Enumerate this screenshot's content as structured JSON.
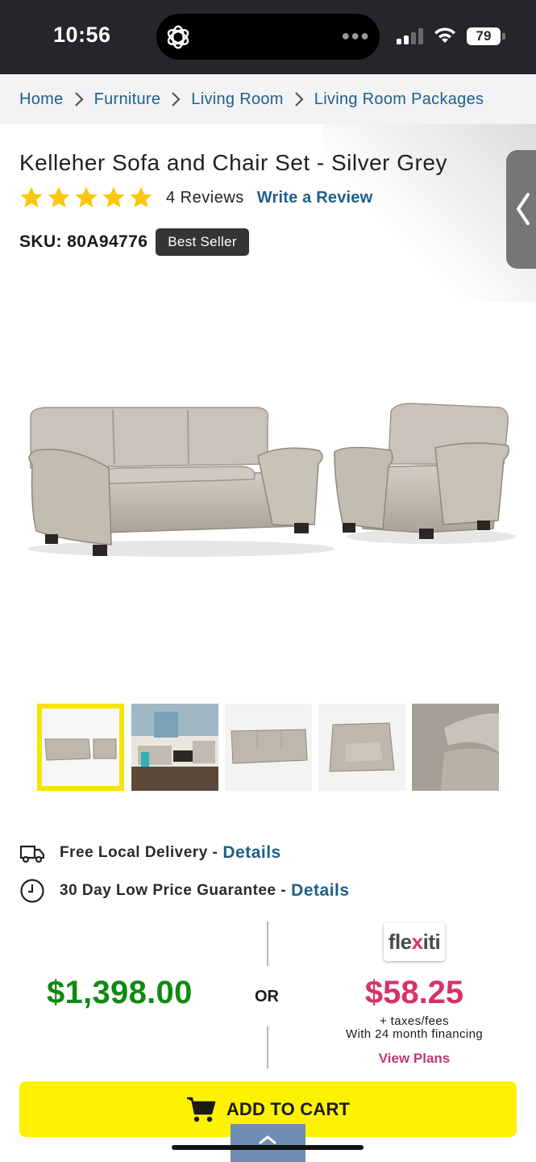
{
  "status_bar": {
    "time": "10:56",
    "battery": "79"
  },
  "breadcrumb": {
    "home": "Home",
    "furniture": "Furniture",
    "living_room": "Living Room",
    "packages": "Living Room Packages"
  },
  "product": {
    "title": "Kelleher Sofa and Chair Set - Silver Grey",
    "rating": 5,
    "reviews_label": "4 Reviews",
    "write_review_label": "Write a Review",
    "sku_label": "SKU: 80A94776",
    "badge": "Best Seller",
    "color": "#c8c2b8"
  },
  "thumbnails": {
    "selected_index": 0,
    "count": 5
  },
  "info": {
    "delivery_label": "Free Local Delivery -",
    "delivery_link": "Details",
    "guarantee_label": "30 Day Low Price Guarantee -",
    "guarantee_link": "Details"
  },
  "pricing": {
    "price": "$1,398.00",
    "or_label": "OR",
    "financing_logo": "flexiti",
    "monthly_price": "$58.25",
    "taxes_note": "+ taxes/fees",
    "financing_note": "With 24 month financing",
    "view_plans_label": "View Plans"
  },
  "cart": {
    "add_to_cart_label": "ADD TO CART"
  },
  "colors": {
    "accent_blue": "#1d5f8a",
    "price_green": "#0e8a12",
    "flexiti_pink": "#d9306d",
    "cart_yellow": "#fff200",
    "star_yellow": "#f9c80e"
  }
}
